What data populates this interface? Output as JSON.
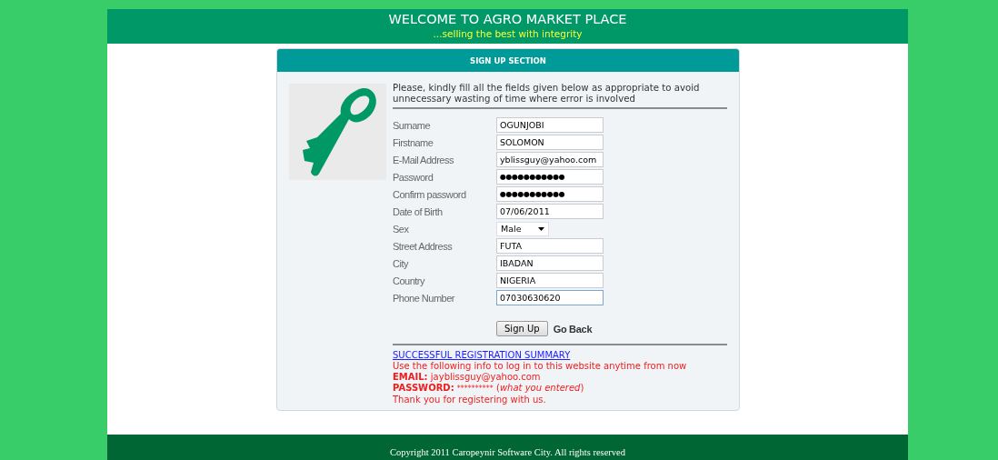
{
  "header": {
    "title": "WELCOME TO AGRO MARKET PLACE",
    "tagline": "...selling the best with integrity"
  },
  "card": {
    "title": "SIGN UP SECTION",
    "intro": "Please, kindly fill all the fields given below as appropriate to avoid unnecessary wasting of time where error is involved",
    "fields": [
      {
        "label": "Surname",
        "kind": "text",
        "value": "OGUNJOBI",
        "focused": false
      },
      {
        "label": "Firstname",
        "kind": "text",
        "value": "SOLOMON",
        "focused": false
      },
      {
        "label": "E-Mail Address",
        "kind": "text",
        "value": "yblissguy@yahoo.com",
        "focused": false
      },
      {
        "label": "Password",
        "kind": "password",
        "value": "●●●●●●●●●●●",
        "focused": false
      },
      {
        "label": "Confirm password",
        "kind": "password",
        "value": "●●●●●●●●●●●",
        "focused": false
      },
      {
        "label": "Date of Birth",
        "kind": "text",
        "value": "07/06/2011",
        "focused": false
      },
      {
        "label": "Sex",
        "kind": "select",
        "value": "Male",
        "focused": false
      },
      {
        "label": "Street Address",
        "kind": "text",
        "value": "FUTA",
        "focused": false
      },
      {
        "label": "City",
        "kind": "text",
        "value": "IBADAN",
        "focused": false
      },
      {
        "label": "Country",
        "kind": "text",
        "value": "NIGERIA",
        "focused": false
      },
      {
        "label": "Phone Number",
        "kind": "text",
        "value": "07030630620",
        "focused": true
      }
    ],
    "submit": "Sign Up",
    "back": "Go Back",
    "summary": {
      "link": "SUCCESSFUL REGISTRATION SUMMARY",
      "lines": [
        {
          "text": "Use the following info to log in to this website anytime from now"
        },
        {
          "label": "EMAIL:",
          "text": "jayblissguy@yahoo.com"
        },
        {
          "label": "PASSWORD:",
          "text": "**********",
          "note": "(*what you entered*)"
        },
        {
          "text": "Thank you for registering with us."
        }
      ]
    }
  },
  "footer": {
    "copyright": "Copyright 2011 Caropeynir Software City. All rights reserved"
  }
}
